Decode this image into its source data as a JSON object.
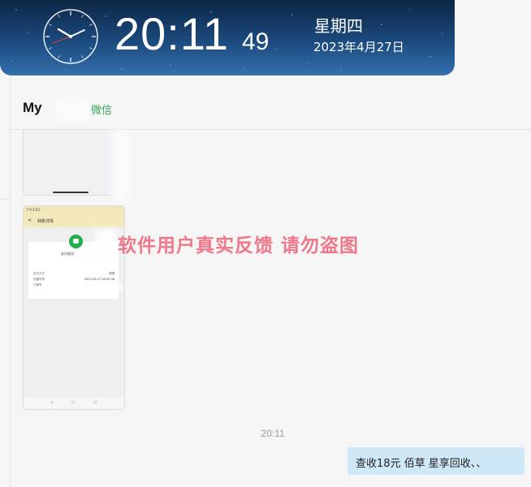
{
  "clock": {
    "time": "20:11",
    "seconds": "49",
    "weekday": "星期四",
    "date": "2023年4月27日"
  },
  "chat": {
    "contact_name": "My",
    "contact_tag": "微信",
    "watermark": "软件用户真实反馈  请勿盗图",
    "timestamp": "20:11",
    "outgoing_message": "查收18元     佰草   星享回收、、"
  },
  "screenshot_thumb": {
    "status_bar": "下午3:03",
    "nav_title": "转账详情",
    "pay_name": "支付成功",
    "rows": [
      {
        "key": "支付方式",
        "value": "花呗"
      },
      {
        "key": "创建时间",
        "value": "2023-04-27 16:50:38"
      },
      {
        "key": "订单号",
        "value": ""
      }
    ],
    "bottom_icons": [
      "▫",
      "○",
      "◁"
    ]
  },
  "colors": {
    "clock_bg_top": "#0d2746",
    "clock_bg_bottom": "#3370ad",
    "watermark": "#ef6d81",
    "bubble_out": "#cfe8f8",
    "tag_green": "#3aa55a"
  }
}
